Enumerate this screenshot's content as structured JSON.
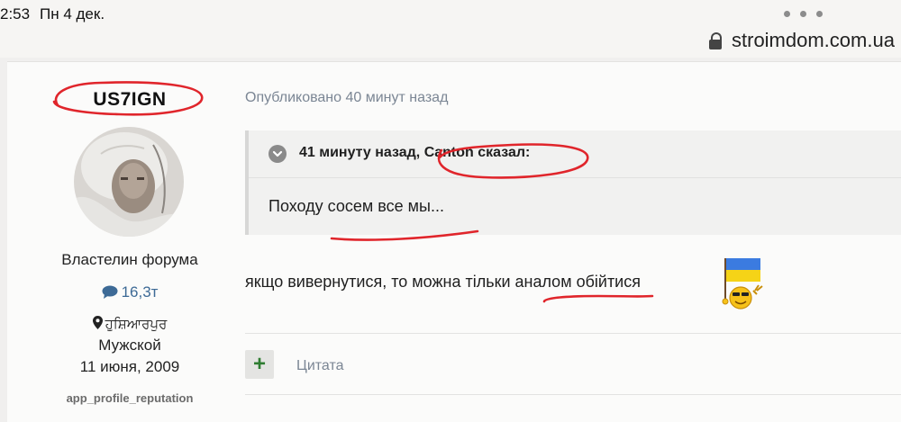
{
  "statusbar": {
    "time": "2:53",
    "date": "Пн 4 дек.",
    "url": "stroimdom.com.ua",
    "icons": [
      "more-dots-icon",
      "lock-icon"
    ]
  },
  "author": {
    "username": "US7IGN",
    "title": "Властелин форума",
    "post_count": "16,3т",
    "location": "ਹੁਸ਼ਿਆਰਪੁਰ",
    "gender": "Мужской",
    "joined": "11 июня, 2009",
    "reputation_label": "app_profile_reputation"
  },
  "post": {
    "published": "Опубликовано 40 минут назад",
    "quote": {
      "header": "41 минуту назад, Canton сказал:",
      "body": "Походу сосем все мы..."
    },
    "text": "якщо вивернутися, то можна тільки аналом обійтися",
    "emoji": "ukraine-flag-smiley",
    "actions": {
      "plus": "+",
      "quote": "Цитата"
    }
  },
  "colors": {
    "annotation_red": "#e0252b",
    "link_blue": "#3d6a96",
    "muted_gray": "#7b8694",
    "plus_green": "#2f7d32"
  }
}
